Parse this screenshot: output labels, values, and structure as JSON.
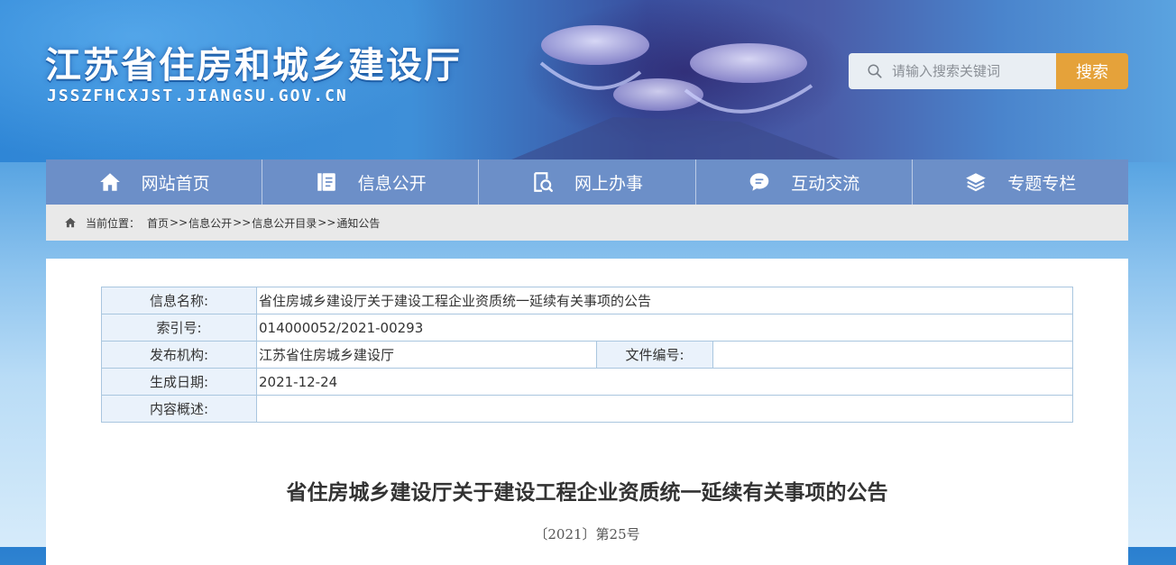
{
  "header": {
    "site_title": "江苏省住房和城乡建设厅",
    "site_domain": "JSSZFHCXJST.JIANGSU.GOV.CN",
    "search": {
      "placeholder": "请输入搜索关键词",
      "button_label": "搜索",
      "icon": "search-icon"
    }
  },
  "nav": {
    "items": [
      {
        "label": "网站首页",
        "icon": "home-icon"
      },
      {
        "label": "信息公开",
        "icon": "document-icon"
      },
      {
        "label": "网上办事",
        "icon": "search-document-icon"
      },
      {
        "label": "互动交流",
        "icon": "chat-icon"
      },
      {
        "label": "专题专栏",
        "icon": "layers-icon"
      }
    ]
  },
  "breadcrumb": {
    "prefix": "当前位置：",
    "items": [
      "首页",
      "信息公开",
      "信息公开目录",
      "通知公告"
    ],
    "separator": ">>",
    "icon": "location-icon"
  },
  "meta": {
    "name_label": "信息名称:",
    "name_value": "省住房城乡建设厅关于建设工程企业资质统一延续有关事项的公告",
    "index_label": "索引号:",
    "index_value": "014000052/2021-00293",
    "publisher_label": "发布机构:",
    "publisher_value": "江苏省住房城乡建设厅",
    "file_no_label": "文件编号:",
    "file_no_value": "",
    "date_label": "生成日期:",
    "date_value": "2021-12-24",
    "summary_label": "内容概述:",
    "summary_value": ""
  },
  "document": {
    "title": "省住房城乡建设厅关于建设工程企业资质统一延续有关事项的公告",
    "number": "〔2021〕第25号"
  },
  "colors": {
    "nav_bg": "#6c8fc8",
    "search_button": "#e5a23a",
    "table_border": "#a9c6df",
    "table_label_bg": "#eaf2fb"
  }
}
